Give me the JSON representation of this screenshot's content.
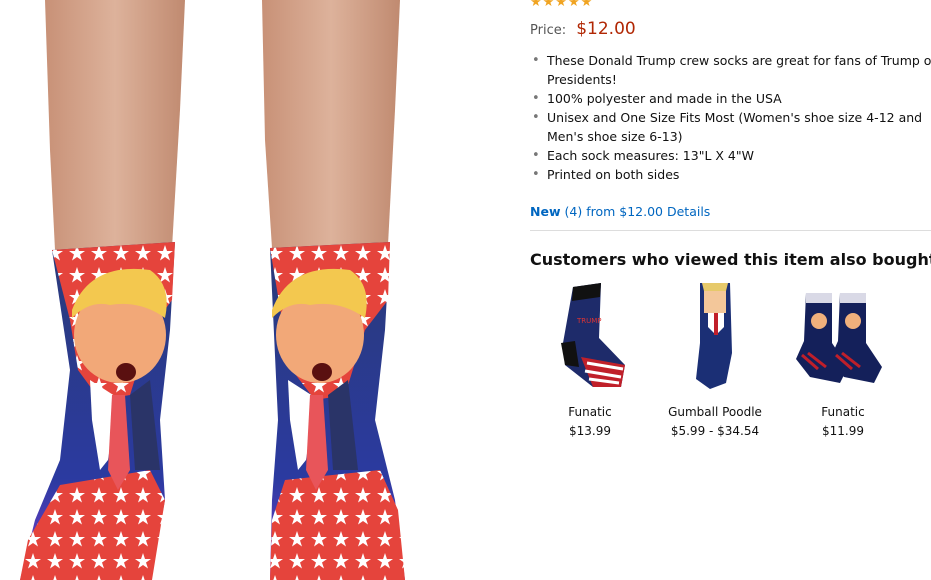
{
  "price": {
    "label": "Price:",
    "value": "$12.00"
  },
  "bullets": [
    "These Donald Trump crew socks are great for fans of Trump or Presidents!",
    "100% polyester and made in the USA",
    "Unisex and One Size Fits Most (Women's shoe size 4-12 and Men's shoe size 6-13)",
    "Each sock measures: 13\"L X 4\"W",
    "Printed on both sides"
  ],
  "offers": {
    "new_label": "New",
    "count": "(4)",
    "from_text": "from $12.00",
    "details_label": "Details"
  },
  "also_bought": {
    "title": "Customers who viewed this item also bought",
    "items": [
      {
        "brand": "Funatic",
        "price": "$13.99"
      },
      {
        "brand": "Gumball Poodle",
        "price": "$5.99 - $34.54"
      },
      {
        "brand": "Funatic",
        "price": "$11.99"
      }
    ]
  },
  "colors": {
    "price_red": "#b12704",
    "link_blue": "#0066c0",
    "star_orange": "#f0a422"
  }
}
